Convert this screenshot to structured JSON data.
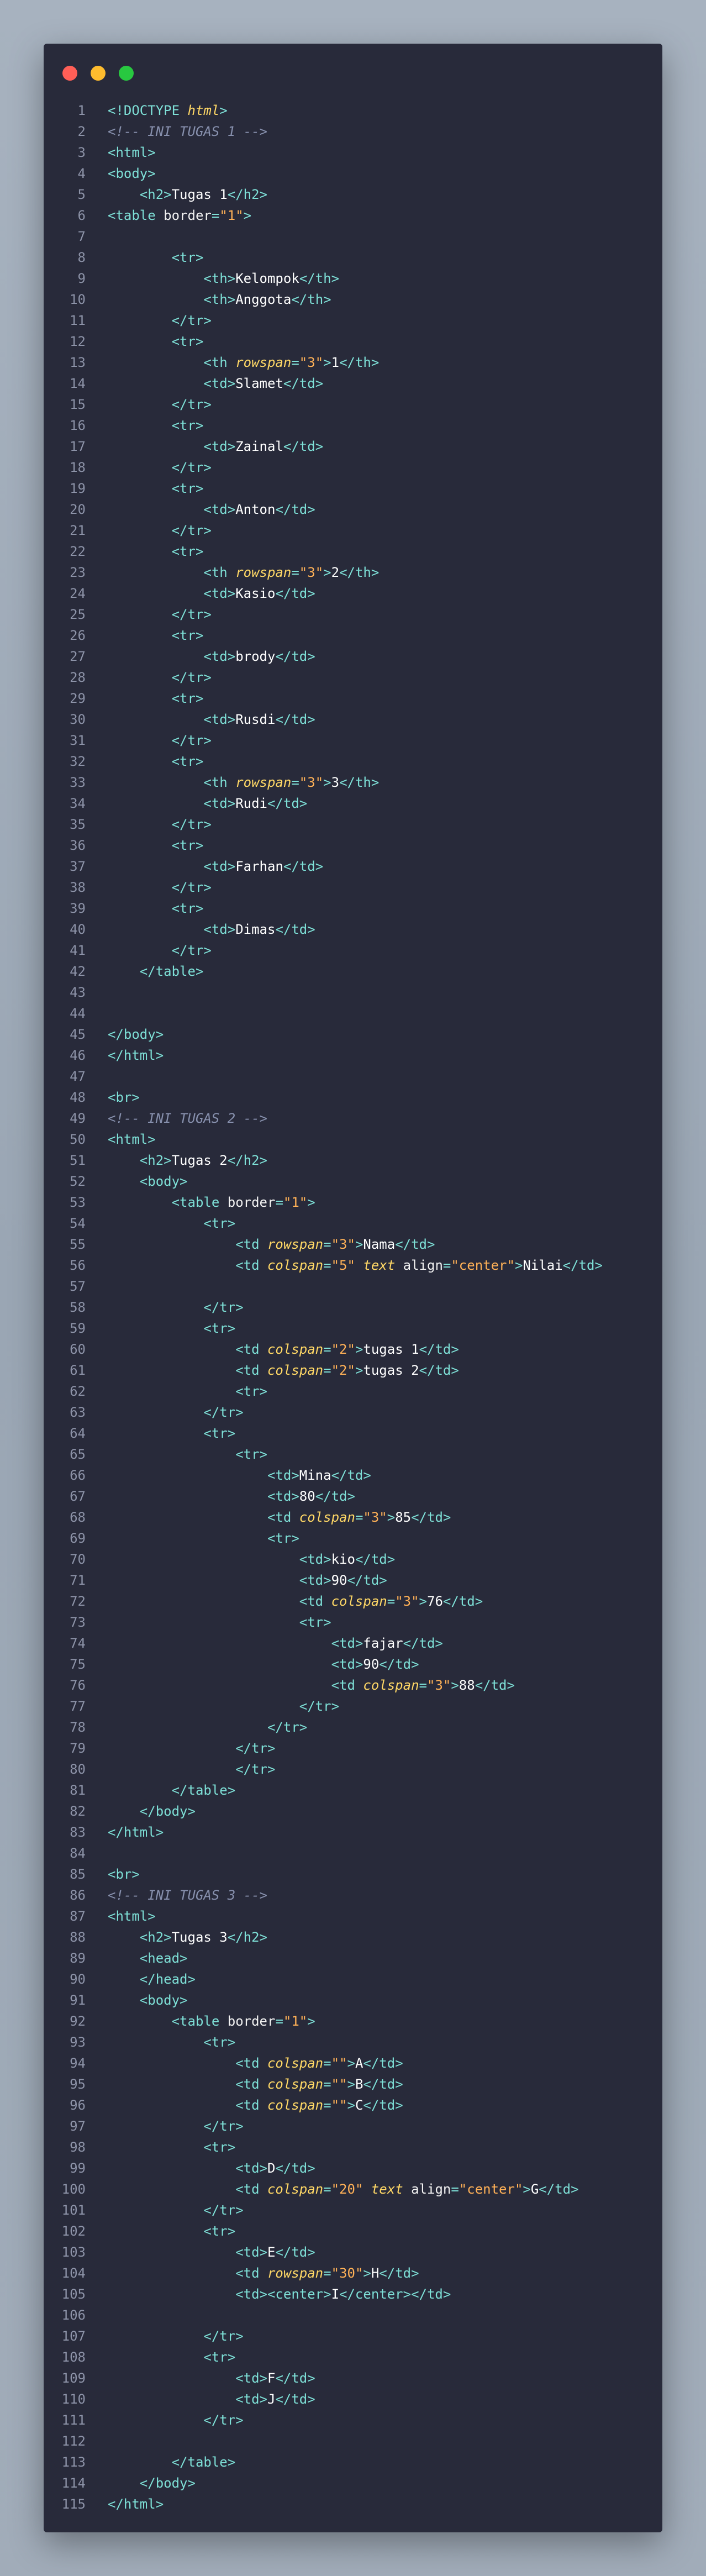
{
  "window": {
    "controls": {
      "close": "#ff5f57",
      "minimize": "#febc2e",
      "zoom": "#28c840"
    }
  },
  "lines": [
    [
      [
        "tag",
        "<!DOCTYPE "
      ],
      [
        "kw",
        "html"
      ],
      [
        "tag",
        ">"
      ]
    ],
    [
      [
        "com",
        "<!-- INI TUGAS 1 -->"
      ]
    ],
    [
      [
        "tag",
        "<html>"
      ]
    ],
    [
      [
        "tag",
        "<body>"
      ]
    ],
    [
      [
        "txt",
        "    "
      ],
      [
        "tag",
        "<h2>"
      ],
      [
        "txt",
        "Tugas 1"
      ],
      [
        "tag",
        "</h2>"
      ]
    ],
    [
      [
        "tag",
        "<table "
      ],
      [
        "attr",
        "border"
      ],
      [
        "tag",
        "="
      ],
      [
        "str",
        "\"1\""
      ],
      [
        "tag",
        ">"
      ]
    ],
    [],
    [
      [
        "txt",
        "        "
      ],
      [
        "tag",
        "<tr>"
      ]
    ],
    [
      [
        "txt",
        "            "
      ],
      [
        "tag",
        "<th>"
      ],
      [
        "txt",
        "Kelompok"
      ],
      [
        "tag",
        "</th>"
      ]
    ],
    [
      [
        "txt",
        "            "
      ],
      [
        "tag",
        "<th>"
      ],
      [
        "txt",
        "Anggota"
      ],
      [
        "tag",
        "</th>"
      ]
    ],
    [
      [
        "txt",
        "        "
      ],
      [
        "tag",
        "</tr>"
      ]
    ],
    [
      [
        "txt",
        "        "
      ],
      [
        "tag",
        "<tr>"
      ]
    ],
    [
      [
        "txt",
        "            "
      ],
      [
        "tag",
        "<th "
      ],
      [
        "attri",
        "rowspan"
      ],
      [
        "tag",
        "="
      ],
      [
        "str",
        "\"3\""
      ],
      [
        "tag",
        ">"
      ],
      [
        "txt",
        "1"
      ],
      [
        "tag",
        "</th>"
      ]
    ],
    [
      [
        "txt",
        "            "
      ],
      [
        "tag",
        "<td>"
      ],
      [
        "txt",
        "Slamet"
      ],
      [
        "tag",
        "</td>"
      ]
    ],
    [
      [
        "txt",
        "        "
      ],
      [
        "tag",
        "</tr>"
      ]
    ],
    [
      [
        "txt",
        "        "
      ],
      [
        "tag",
        "<tr>"
      ]
    ],
    [
      [
        "txt",
        "            "
      ],
      [
        "tag",
        "<td>"
      ],
      [
        "txt",
        "Zainal"
      ],
      [
        "tag",
        "</td>"
      ]
    ],
    [
      [
        "txt",
        "        "
      ],
      [
        "tag",
        "</tr>"
      ]
    ],
    [
      [
        "txt",
        "        "
      ],
      [
        "tag",
        "<tr>"
      ]
    ],
    [
      [
        "txt",
        "            "
      ],
      [
        "tag",
        "<td>"
      ],
      [
        "txt",
        "Anton"
      ],
      [
        "tag",
        "</td>"
      ]
    ],
    [
      [
        "txt",
        "        "
      ],
      [
        "tag",
        "</tr>"
      ]
    ],
    [
      [
        "txt",
        "        "
      ],
      [
        "tag",
        "<tr>"
      ]
    ],
    [
      [
        "txt",
        "            "
      ],
      [
        "tag",
        "<th "
      ],
      [
        "attri",
        "rowspan"
      ],
      [
        "tag",
        "="
      ],
      [
        "str",
        "\"3\""
      ],
      [
        "tag",
        ">"
      ],
      [
        "txt",
        "2"
      ],
      [
        "tag",
        "</th>"
      ]
    ],
    [
      [
        "txt",
        "            "
      ],
      [
        "tag",
        "<td>"
      ],
      [
        "txt",
        "Kasio"
      ],
      [
        "tag",
        "</td>"
      ]
    ],
    [
      [
        "txt",
        "        "
      ],
      [
        "tag",
        "</tr>"
      ]
    ],
    [
      [
        "txt",
        "        "
      ],
      [
        "tag",
        "<tr>"
      ]
    ],
    [
      [
        "txt",
        "            "
      ],
      [
        "tag",
        "<td>"
      ],
      [
        "txt",
        "brody"
      ],
      [
        "tag",
        "</td>"
      ]
    ],
    [
      [
        "txt",
        "        "
      ],
      [
        "tag",
        "</tr>"
      ]
    ],
    [
      [
        "txt",
        "        "
      ],
      [
        "tag",
        "<tr>"
      ]
    ],
    [
      [
        "txt",
        "            "
      ],
      [
        "tag",
        "<td>"
      ],
      [
        "txt",
        "Rusdi"
      ],
      [
        "tag",
        "</td>"
      ]
    ],
    [
      [
        "txt",
        "        "
      ],
      [
        "tag",
        "</tr>"
      ]
    ],
    [
      [
        "txt",
        "        "
      ],
      [
        "tag",
        "<tr>"
      ]
    ],
    [
      [
        "txt",
        "            "
      ],
      [
        "tag",
        "<th "
      ],
      [
        "attri",
        "rowspan"
      ],
      [
        "tag",
        "="
      ],
      [
        "str",
        "\"3\""
      ],
      [
        "tag",
        ">"
      ],
      [
        "txt",
        "3"
      ],
      [
        "tag",
        "</th>"
      ]
    ],
    [
      [
        "txt",
        "            "
      ],
      [
        "tag",
        "<td>"
      ],
      [
        "txt",
        "Rudi"
      ],
      [
        "tag",
        "</td>"
      ]
    ],
    [
      [
        "txt",
        "        "
      ],
      [
        "tag",
        "</tr>"
      ]
    ],
    [
      [
        "txt",
        "        "
      ],
      [
        "tag",
        "<tr>"
      ]
    ],
    [
      [
        "txt",
        "            "
      ],
      [
        "tag",
        "<td>"
      ],
      [
        "txt",
        "Farhan"
      ],
      [
        "tag",
        "</td>"
      ]
    ],
    [
      [
        "txt",
        "        "
      ],
      [
        "tag",
        "</tr>"
      ]
    ],
    [
      [
        "txt",
        "        "
      ],
      [
        "tag",
        "<tr>"
      ]
    ],
    [
      [
        "txt",
        "            "
      ],
      [
        "tag",
        "<td>"
      ],
      [
        "txt",
        "Dimas"
      ],
      [
        "tag",
        "</td>"
      ]
    ],
    [
      [
        "txt",
        "        "
      ],
      [
        "tag",
        "</tr>"
      ]
    ],
    [
      [
        "txt",
        "    "
      ],
      [
        "tag",
        "</table>"
      ]
    ],
    [],
    [],
    [
      [
        "tag",
        "</body>"
      ]
    ],
    [
      [
        "tag",
        "</html>"
      ]
    ],
    [],
    [
      [
        "tag",
        "<br>"
      ]
    ],
    [
      [
        "com",
        "<!-- INI TUGAS 2 -->"
      ]
    ],
    [
      [
        "tag",
        "<html>"
      ]
    ],
    [
      [
        "txt",
        "    "
      ],
      [
        "tag",
        "<h2>"
      ],
      [
        "txt",
        "Tugas 2"
      ],
      [
        "tag",
        "</h2>"
      ]
    ],
    [
      [
        "txt",
        "    "
      ],
      [
        "tag",
        "<body>"
      ]
    ],
    [
      [
        "txt",
        "        "
      ],
      [
        "tag",
        "<table "
      ],
      [
        "attr",
        "border"
      ],
      [
        "tag",
        "="
      ],
      [
        "str",
        "\"1\""
      ],
      [
        "tag",
        ">"
      ]
    ],
    [
      [
        "txt",
        "            "
      ],
      [
        "tag",
        "<tr>"
      ]
    ],
    [
      [
        "txt",
        "                "
      ],
      [
        "tag",
        "<td "
      ],
      [
        "attri",
        "rowspan"
      ],
      [
        "tag",
        "="
      ],
      [
        "str",
        "\"3\""
      ],
      [
        "tag",
        ">"
      ],
      [
        "txt",
        "Nama"
      ],
      [
        "tag",
        "</td>"
      ]
    ],
    [
      [
        "txt",
        "                "
      ],
      [
        "tag",
        "<td "
      ],
      [
        "attri",
        "colspan"
      ],
      [
        "tag",
        "="
      ],
      [
        "str",
        "\"5\""
      ],
      [
        "txt",
        " "
      ],
      [
        "attri",
        "text"
      ],
      [
        "txt",
        " "
      ],
      [
        "attr",
        "align"
      ],
      [
        "tag",
        "="
      ],
      [
        "str",
        "\"center\""
      ],
      [
        "tag",
        ">"
      ],
      [
        "txt",
        "Nilai"
      ],
      [
        "tag",
        "</td>"
      ]
    ],
    [],
    [
      [
        "txt",
        "            "
      ],
      [
        "tag",
        "</tr>"
      ]
    ],
    [
      [
        "txt",
        "            "
      ],
      [
        "tag",
        "<tr>"
      ]
    ],
    [
      [
        "txt",
        "                "
      ],
      [
        "tag",
        "<td "
      ],
      [
        "attri",
        "colspan"
      ],
      [
        "tag",
        "="
      ],
      [
        "str",
        "\"2\""
      ],
      [
        "tag",
        ">"
      ],
      [
        "txt",
        "tugas 1"
      ],
      [
        "tag",
        "</td>"
      ]
    ],
    [
      [
        "txt",
        "                "
      ],
      [
        "tag",
        "<td "
      ],
      [
        "attri",
        "colspan"
      ],
      [
        "tag",
        "="
      ],
      [
        "str",
        "\"2\""
      ],
      [
        "tag",
        ">"
      ],
      [
        "txt",
        "tugas 2"
      ],
      [
        "tag",
        "</td>"
      ]
    ],
    [
      [
        "txt",
        "                "
      ],
      [
        "tag",
        "<tr>"
      ]
    ],
    [
      [
        "txt",
        "            "
      ],
      [
        "tag",
        "</tr>"
      ]
    ],
    [
      [
        "txt",
        "            "
      ],
      [
        "tag",
        "<tr>"
      ]
    ],
    [
      [
        "txt",
        "                "
      ],
      [
        "tag",
        "<tr>"
      ]
    ],
    [
      [
        "txt",
        "                    "
      ],
      [
        "tag",
        "<td>"
      ],
      [
        "txt",
        "Mina"
      ],
      [
        "tag",
        "</td>"
      ]
    ],
    [
      [
        "txt",
        "                    "
      ],
      [
        "tag",
        "<td>"
      ],
      [
        "txt",
        "80"
      ],
      [
        "tag",
        "</td>"
      ]
    ],
    [
      [
        "txt",
        "                    "
      ],
      [
        "tag",
        "<td "
      ],
      [
        "attri",
        "colspan"
      ],
      [
        "tag",
        "="
      ],
      [
        "str",
        "\"3\""
      ],
      [
        "tag",
        ">"
      ],
      [
        "txt",
        "85"
      ],
      [
        "tag",
        "</td>"
      ]
    ],
    [
      [
        "txt",
        "                    "
      ],
      [
        "tag",
        "<tr>"
      ]
    ],
    [
      [
        "txt",
        "                        "
      ],
      [
        "tag",
        "<td>"
      ],
      [
        "txt",
        "kio"
      ],
      [
        "tag",
        "</td>"
      ]
    ],
    [
      [
        "txt",
        "                        "
      ],
      [
        "tag",
        "<td>"
      ],
      [
        "txt",
        "90"
      ],
      [
        "tag",
        "</td>"
      ]
    ],
    [
      [
        "txt",
        "                        "
      ],
      [
        "tag",
        "<td "
      ],
      [
        "attri",
        "colspan"
      ],
      [
        "tag",
        "="
      ],
      [
        "str",
        "\"3\""
      ],
      [
        "tag",
        ">"
      ],
      [
        "txt",
        "76"
      ],
      [
        "tag",
        "</td>"
      ]
    ],
    [
      [
        "txt",
        "                        "
      ],
      [
        "tag",
        "<tr>"
      ]
    ],
    [
      [
        "txt",
        "                            "
      ],
      [
        "tag",
        "<td>"
      ],
      [
        "txt",
        "fajar"
      ],
      [
        "tag",
        "</td>"
      ]
    ],
    [
      [
        "txt",
        "                            "
      ],
      [
        "tag",
        "<td>"
      ],
      [
        "txt",
        "90"
      ],
      [
        "tag",
        "</td>"
      ]
    ],
    [
      [
        "txt",
        "                            "
      ],
      [
        "tag",
        "<td "
      ],
      [
        "attri",
        "colspan"
      ],
      [
        "tag",
        "="
      ],
      [
        "str",
        "\"3\""
      ],
      [
        "tag",
        ">"
      ],
      [
        "txt",
        "88"
      ],
      [
        "tag",
        "</td>"
      ]
    ],
    [
      [
        "txt",
        "                        "
      ],
      [
        "tag",
        "</tr>"
      ]
    ],
    [
      [
        "txt",
        "                    "
      ],
      [
        "tag",
        "</tr>"
      ]
    ],
    [
      [
        "txt",
        "                "
      ],
      [
        "tag",
        "</tr>"
      ]
    ],
    [
      [
        "txt",
        "                "
      ],
      [
        "tag",
        "</tr>"
      ]
    ],
    [
      [
        "txt",
        "        "
      ],
      [
        "tag",
        "</table>"
      ]
    ],
    [
      [
        "txt",
        "    "
      ],
      [
        "tag",
        "</body>"
      ]
    ],
    [
      [
        "tag",
        "</html>"
      ]
    ],
    [],
    [
      [
        "tag",
        "<br>"
      ]
    ],
    [
      [
        "com",
        "<!-- INI TUGAS 3 -->"
      ]
    ],
    [
      [
        "tag",
        "<html>"
      ]
    ],
    [
      [
        "txt",
        "    "
      ],
      [
        "tag",
        "<h2>"
      ],
      [
        "txt",
        "Tugas 3"
      ],
      [
        "tag",
        "</h2>"
      ]
    ],
    [
      [
        "txt",
        "    "
      ],
      [
        "tag",
        "<head>"
      ]
    ],
    [
      [
        "txt",
        "    "
      ],
      [
        "tag",
        "</head>"
      ]
    ],
    [
      [
        "txt",
        "    "
      ],
      [
        "tag",
        "<body>"
      ]
    ],
    [
      [
        "txt",
        "        "
      ],
      [
        "tag",
        "<table "
      ],
      [
        "attr",
        "border"
      ],
      [
        "tag",
        "="
      ],
      [
        "str",
        "\"1\""
      ],
      [
        "tag",
        ">"
      ]
    ],
    [
      [
        "txt",
        "            "
      ],
      [
        "tag",
        "<tr>"
      ]
    ],
    [
      [
        "txt",
        "                "
      ],
      [
        "tag",
        "<td "
      ],
      [
        "attri",
        "colspan"
      ],
      [
        "tag",
        "="
      ],
      [
        "str",
        "\"\""
      ],
      [
        "tag",
        ">"
      ],
      [
        "txt",
        "A"
      ],
      [
        "tag",
        "</td>"
      ]
    ],
    [
      [
        "txt",
        "                "
      ],
      [
        "tag",
        "<td "
      ],
      [
        "attri",
        "colspan"
      ],
      [
        "tag",
        "="
      ],
      [
        "str",
        "\"\""
      ],
      [
        "tag",
        ">"
      ],
      [
        "txt",
        "B"
      ],
      [
        "tag",
        "</td>"
      ]
    ],
    [
      [
        "txt",
        "                "
      ],
      [
        "tag",
        "<td "
      ],
      [
        "attri",
        "colspan"
      ],
      [
        "tag",
        "="
      ],
      [
        "str",
        "\"\""
      ],
      [
        "tag",
        ">"
      ],
      [
        "txt",
        "C"
      ],
      [
        "tag",
        "</td>"
      ]
    ],
    [
      [
        "txt",
        "            "
      ],
      [
        "tag",
        "</tr>"
      ]
    ],
    [
      [
        "txt",
        "            "
      ],
      [
        "tag",
        "<tr>"
      ]
    ],
    [
      [
        "txt",
        "                "
      ],
      [
        "tag",
        "<td>"
      ],
      [
        "txt",
        "D"
      ],
      [
        "tag",
        "</td>"
      ]
    ],
    [
      [
        "txt",
        "                "
      ],
      [
        "tag",
        "<td "
      ],
      [
        "attri",
        "colspan"
      ],
      [
        "tag",
        "="
      ],
      [
        "str",
        "\"20\""
      ],
      [
        "txt",
        " "
      ],
      [
        "attri",
        "text"
      ],
      [
        "txt",
        " "
      ],
      [
        "attr",
        "align"
      ],
      [
        "tag",
        "="
      ],
      [
        "str",
        "\"center\""
      ],
      [
        "tag",
        ">"
      ],
      [
        "txt",
        "G"
      ],
      [
        "tag",
        "</td>"
      ]
    ],
    [
      [
        "txt",
        "            "
      ],
      [
        "tag",
        "</tr>"
      ]
    ],
    [
      [
        "txt",
        "            "
      ],
      [
        "tag",
        "<tr>"
      ]
    ],
    [
      [
        "txt",
        "                "
      ],
      [
        "tag",
        "<td>"
      ],
      [
        "txt",
        "E"
      ],
      [
        "tag",
        "</td>"
      ]
    ],
    [
      [
        "txt",
        "                "
      ],
      [
        "tag",
        "<td "
      ],
      [
        "attri",
        "rowspan"
      ],
      [
        "tag",
        "="
      ],
      [
        "str",
        "\"30\""
      ],
      [
        "tag",
        ">"
      ],
      [
        "txt",
        "H"
      ],
      [
        "tag",
        "</td>"
      ]
    ],
    [
      [
        "txt",
        "                "
      ],
      [
        "tag",
        "<td>"
      ],
      [
        "tag",
        "<center>"
      ],
      [
        "txt",
        "I"
      ],
      [
        "tag",
        "</center>"
      ],
      [
        "tag",
        "</td>"
      ]
    ],
    [],
    [
      [
        "txt",
        "            "
      ],
      [
        "tag",
        "</tr>"
      ]
    ],
    [
      [
        "txt",
        "            "
      ],
      [
        "tag",
        "<tr>"
      ]
    ],
    [
      [
        "txt",
        "                "
      ],
      [
        "tag",
        "<td>"
      ],
      [
        "txt",
        "F"
      ],
      [
        "tag",
        "</td>"
      ]
    ],
    [
      [
        "txt",
        "                "
      ],
      [
        "tag",
        "<td>"
      ],
      [
        "txt",
        "J"
      ],
      [
        "tag",
        "</td>"
      ]
    ],
    [
      [
        "txt",
        "            "
      ],
      [
        "tag",
        "</tr>"
      ]
    ],
    [],
    [
      [
        "txt",
        "        "
      ],
      [
        "tag",
        "</table>"
      ]
    ],
    [
      [
        "txt",
        "    "
      ],
      [
        "tag",
        "</body>"
      ]
    ],
    [
      [
        "tag",
        "</html>"
      ]
    ]
  ]
}
